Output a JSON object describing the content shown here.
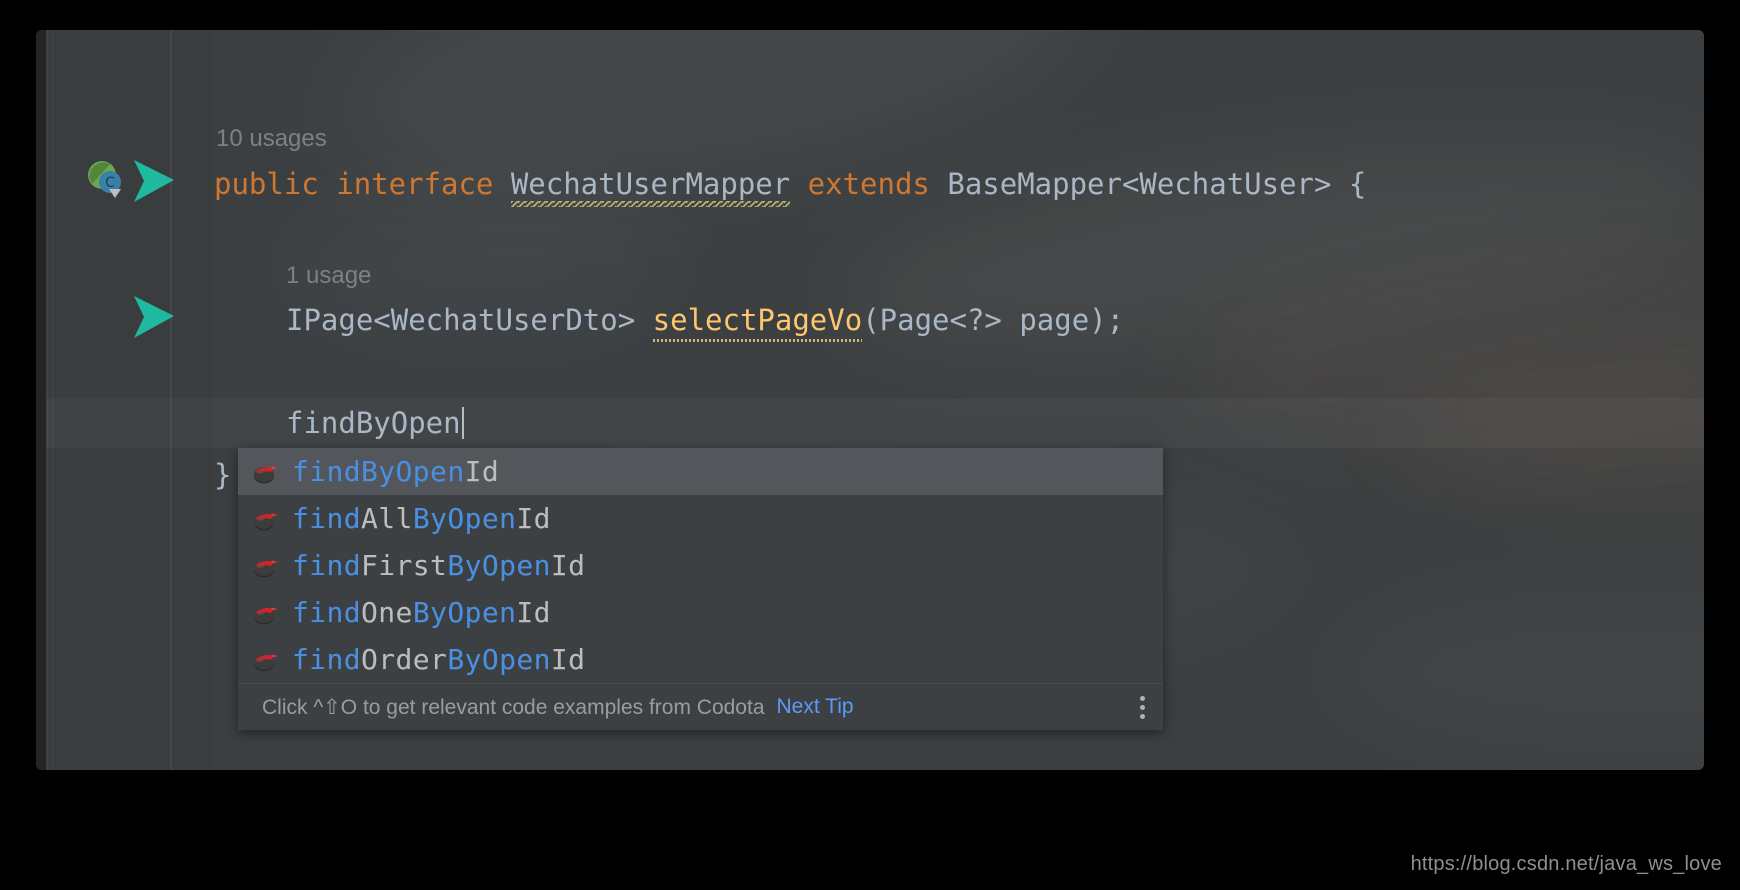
{
  "editor": {
    "usage_hint_class": "10 usages",
    "usage_hint_method": "1 usage",
    "line1": {
      "kw_public": "public",
      "kw_interface": "interface",
      "type_name": "WechatUserMapper",
      "kw_extends": "extends",
      "tail": "BaseMapper<WechatUser> {"
    },
    "line2": {
      "return_type": "IPage<WechatUserDto>",
      "method_name": "selectPageVo",
      "params": "(Page<?> page);"
    },
    "typed_text": "findByOpen",
    "closing_brace": "}"
  },
  "gutter": {
    "codota_icon": "codota-gutter-icon",
    "implementation_arrow_icon": "implemented-method-arrow-icon"
  },
  "completion": {
    "items": [
      {
        "match": "findByOpen",
        "rest": "Id",
        "icon": "method-icon",
        "selected": true
      },
      {
        "match": "find",
        "rest": "All",
        "match2": "ByOpen",
        "rest2": "Id",
        "icon": "method-icon",
        "selected": false
      },
      {
        "match": "find",
        "rest": "First",
        "match2": "ByOpen",
        "rest2": "Id",
        "icon": "method-icon",
        "selected": false
      },
      {
        "match": "find",
        "rest": "One",
        "match2": "ByOpen",
        "rest2": "Id",
        "icon": "method-icon",
        "selected": false
      },
      {
        "match": "find",
        "rest": "Order",
        "match2": "ByOpen",
        "rest2": "Id",
        "icon": "method-icon",
        "selected": false
      }
    ],
    "footer_text": "Click ^⇧O to get relevant code examples from Codota",
    "next_tip_label": "Next Tip",
    "menu_icon": "more-options-icon"
  },
  "watermark": "https://blog.csdn.net/java_ws_love",
  "colors": {
    "keyword": "#cc7832",
    "identifier": "#a9b7c6",
    "method": "#ffc66d",
    "match_highlight": "#4a90e2",
    "rest_text": "#bdbdbd",
    "link": "#5b9bf8",
    "editor_bg": "#3c3f41",
    "popup_bg": "#3d4043",
    "popup_selected_bg": "#53575b"
  }
}
